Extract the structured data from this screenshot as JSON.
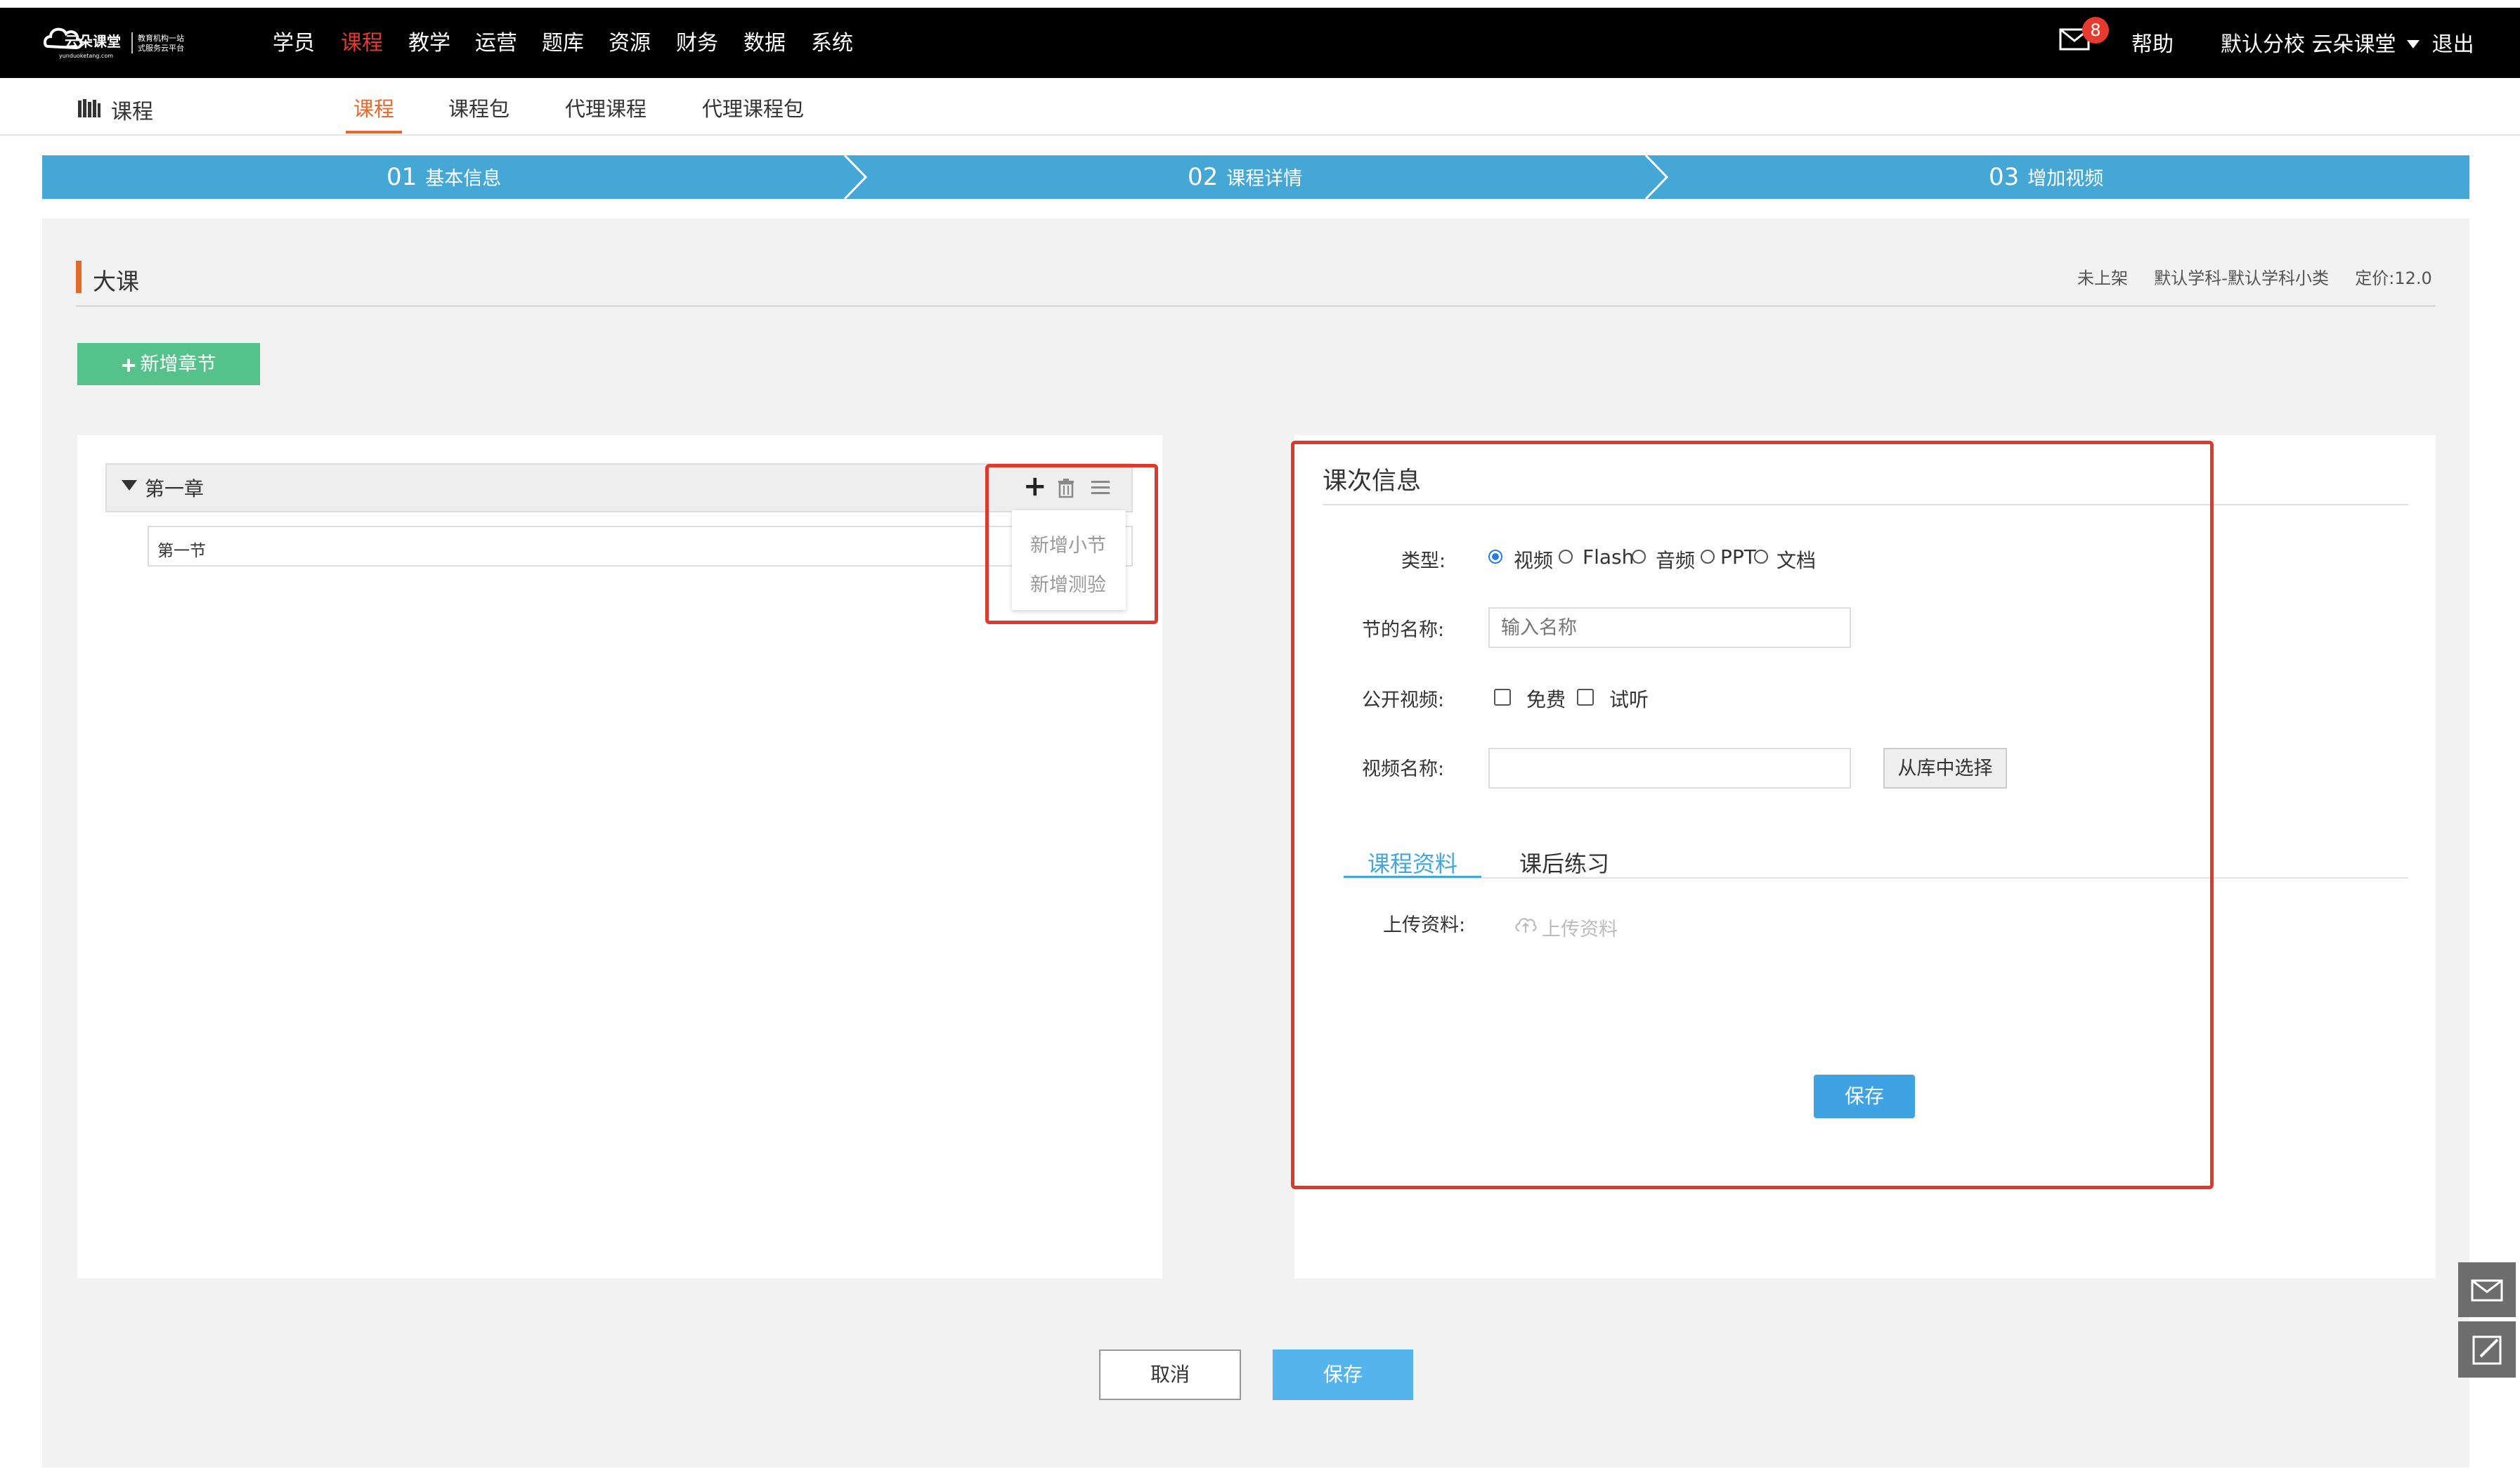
{
  "header": {
    "logo_text": "云朵课堂",
    "logo_slogan_1": "教育机构一站",
    "logo_slogan_2": "式服务云平台",
    "logo_url_text": "yunduoketang.com",
    "nav": [
      {
        "label": "学员",
        "active": false
      },
      {
        "label": "课程",
        "active": true
      },
      {
        "label": "教学",
        "active": false
      },
      {
        "label": "运营",
        "active": false
      },
      {
        "label": "题库",
        "active": false
      },
      {
        "label": "资源",
        "active": false
      },
      {
        "label": "财务",
        "active": false
      },
      {
        "label": "数据",
        "active": false
      },
      {
        "label": "系统",
        "active": false
      }
    ],
    "mail_badge": "8",
    "help": "帮助",
    "user_info": "默认分校  云朵课堂",
    "logout": "退出"
  },
  "subnav": {
    "title": "课程",
    "tabs": [
      {
        "label": "课程",
        "active": true
      },
      {
        "label": "课程包",
        "active": false
      },
      {
        "label": "代理课程",
        "active": false
      },
      {
        "label": "代理课程包",
        "active": false
      }
    ]
  },
  "steps": [
    {
      "num": "01",
      "label": "基本信息"
    },
    {
      "num": "02",
      "label": "课程详情"
    },
    {
      "num": "03",
      "label": "增加视频"
    }
  ],
  "course": {
    "title": "大课",
    "status": "未上架",
    "category": "默认学科-默认学科小类",
    "price": "定价:12.0"
  },
  "add_chapter_label": "新增章节",
  "chapter": {
    "name": "第一章",
    "section": "第一节",
    "actions": [
      "新增小节",
      "新增测验"
    ]
  },
  "lesson_info": {
    "title": "课次信息",
    "type_label": "类型:",
    "types": [
      "视频",
      "Flash",
      "音频",
      "PPT",
      "文档"
    ],
    "selected_type": "视频",
    "name_label": "节的名称:",
    "name_placeholder": "输入名称",
    "public_label": "公开视频:",
    "public_options": [
      "免费",
      "试听"
    ],
    "video_label": "视频名称:",
    "video_value": "",
    "library_button": "从库中选择",
    "tabs": [
      "课程资料",
      "课后练习"
    ],
    "upload_label": "上传资料:",
    "upload_button": "上传资料",
    "save": "保存"
  },
  "footer_buttons": {
    "cancel": "取消",
    "save": "保存"
  },
  "colors": {
    "accent_blue": "#45a7d6",
    "active_red": "#e23c30",
    "tab_orange": "#e36a2b",
    "green_button": "#56c28b",
    "highlight_red": "#e0392b"
  }
}
